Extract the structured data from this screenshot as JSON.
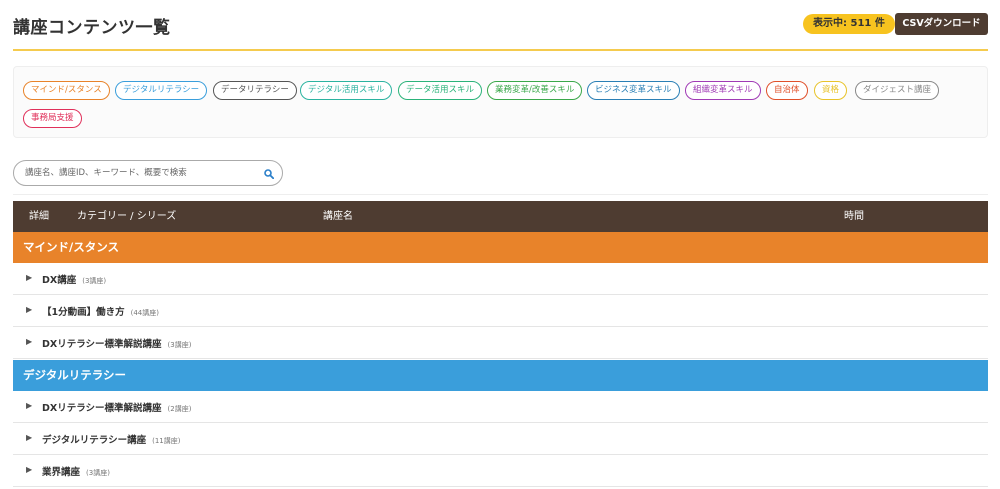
{
  "header": {
    "title": "講座コンテンツ一覧",
    "count_badge": "表示中: 511 件",
    "csv_button": "CSVダウンロード"
  },
  "filters": [
    {
      "label": "マインド/スタンス",
      "color": "#e8832a"
    },
    {
      "label": "デジタルリテラシー",
      "color": "#3a9edb"
    },
    {
      "label": "データリテラシー",
      "color": "#555555"
    },
    {
      "label": "デジタル活用スキル",
      "color": "#2bb3a0"
    },
    {
      "label": "データ活用スキル",
      "color": "#2bb37a"
    },
    {
      "label": "業務変革/改善スキル",
      "color": "#3aa84a"
    },
    {
      "label": "ビジネス変革スキル",
      "color": "#2a7fb5"
    },
    {
      "label": "組織変革スキル",
      "color": "#a03ab5"
    },
    {
      "label": "自治体",
      "color": "#e0502a"
    },
    {
      "label": "資格",
      "color": "#e8c32a"
    },
    {
      "label": "ダイジェスト講座",
      "color": "#888888"
    },
    {
      "label": "事務局支援",
      "color": "#e0305a"
    }
  ],
  "search": {
    "placeholder": "講座名、講座ID、キーワード、概要で検索"
  },
  "table": {
    "headers": {
      "detail": "詳細",
      "category": "カテゴリー / シリーズ",
      "name": "講座名",
      "time": "時間"
    },
    "categories": [
      {
        "name": "マインド/スタンス",
        "color": "#e8832a",
        "items": [
          {
            "label": "DX講座",
            "count": "(3講座)"
          },
          {
            "label": "【1分動画】働き方",
            "count": "(44講座)"
          },
          {
            "label": "DXリテラシー標準解説講座",
            "count": "(3講座)"
          }
        ]
      },
      {
        "name": "デジタルリテラシー",
        "color": "#3a9edb",
        "items": [
          {
            "label": "DXリテラシー標準解説講座",
            "count": "(2講座)"
          },
          {
            "label": "デジタルリテラシー講座",
            "count": "(11講座)"
          },
          {
            "label": "業界講座",
            "count": "(3講座)"
          }
        ]
      }
    ]
  }
}
